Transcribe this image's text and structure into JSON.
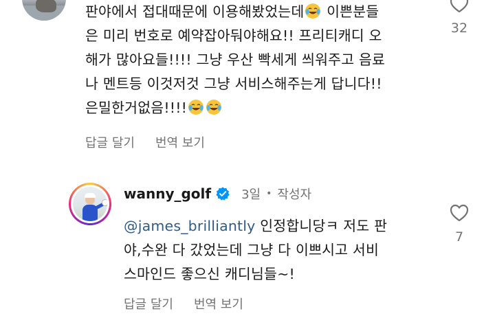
{
  "comment1": {
    "lines": [
      [
        "판야에서 접대때문에 이용해봤었는데",
        "😂",
        " 이쁜분들"
      ],
      [
        "은 미리 번호로 예약잡아둬야해요!! 프리티캐디 오"
      ],
      [
        "해가 많아요들!!!! 그냥 우산 빡세게 씌워주고 음료"
      ],
      [
        "나 멘트등 이것저것 그냥 서비스해주는게 답니다!!"
      ],
      [
        "은밀한거없음!!!!",
        "😂😂"
      ]
    ],
    "line1_a": "판야에서 접대때문에 이용해봤었는데",
    "line1_b": "이쁜분들",
    "line2": "은 미리 번호로 예약잡아둬야해요!! 프리티캐디 오",
    "line3": "해가 많아요들!!!! 그냥 우산 빡세게 씌워주고 음료",
    "line4": "나 멘트등 이것저것 그냥 서비스해주는게 답니다!!",
    "line5": "은밀한거없음!!!!",
    "reply_label": "답글 달기",
    "translate_label": "번역 보기",
    "like_count": "32"
  },
  "comment2": {
    "username": "wanny_golf",
    "time": "3일",
    "author_badge": "작성자",
    "mention": "@james_brilliantly",
    "line1_rest": " 인정합니당ㅋ 저도 판",
    "line2": "야,수완 다 갔었는데 그냥 다 이쁘시고 서비",
    "line3": "스마인드 좋으신 캐디님들~!",
    "reply_label": "답글 달기",
    "translate_label": "번역 보기",
    "like_count": "7"
  },
  "colors": {
    "text": "#1a1a1a",
    "secondary": "#737373",
    "mention": "#2e5c8a",
    "verified": "#0095f6"
  },
  "icons": [
    "heart-outline-icon",
    "verified-badge-icon",
    "tears-of-joy-emoji"
  ]
}
